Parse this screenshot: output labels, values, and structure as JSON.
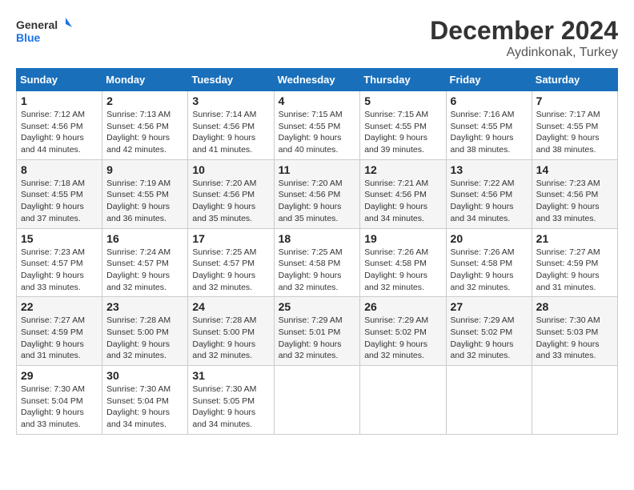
{
  "logo": {
    "line1": "General",
    "line2": "Blue"
  },
  "title": "December 2024",
  "location": "Aydinkonak, Turkey",
  "weekdays": [
    "Sunday",
    "Monday",
    "Tuesday",
    "Wednesday",
    "Thursday",
    "Friday",
    "Saturday"
  ],
  "weeks": [
    [
      {
        "day": "1",
        "sunrise": "7:12 AM",
        "sunset": "4:56 PM",
        "daylight": "9 hours and 44 minutes."
      },
      {
        "day": "2",
        "sunrise": "7:13 AM",
        "sunset": "4:56 PM",
        "daylight": "9 hours and 42 minutes."
      },
      {
        "day": "3",
        "sunrise": "7:14 AM",
        "sunset": "4:56 PM",
        "daylight": "9 hours and 41 minutes."
      },
      {
        "day": "4",
        "sunrise": "7:15 AM",
        "sunset": "4:55 PM",
        "daylight": "9 hours and 40 minutes."
      },
      {
        "day": "5",
        "sunrise": "7:15 AM",
        "sunset": "4:55 PM",
        "daylight": "9 hours and 39 minutes."
      },
      {
        "day": "6",
        "sunrise": "7:16 AM",
        "sunset": "4:55 PM",
        "daylight": "9 hours and 38 minutes."
      },
      {
        "day": "7",
        "sunrise": "7:17 AM",
        "sunset": "4:55 PM",
        "daylight": "9 hours and 38 minutes."
      }
    ],
    [
      {
        "day": "8",
        "sunrise": "7:18 AM",
        "sunset": "4:55 PM",
        "daylight": "9 hours and 37 minutes."
      },
      {
        "day": "9",
        "sunrise": "7:19 AM",
        "sunset": "4:55 PM",
        "daylight": "9 hours and 36 minutes."
      },
      {
        "day": "10",
        "sunrise": "7:20 AM",
        "sunset": "4:56 PM",
        "daylight": "9 hours and 35 minutes."
      },
      {
        "day": "11",
        "sunrise": "7:20 AM",
        "sunset": "4:56 PM",
        "daylight": "9 hours and 35 minutes."
      },
      {
        "day": "12",
        "sunrise": "7:21 AM",
        "sunset": "4:56 PM",
        "daylight": "9 hours and 34 minutes."
      },
      {
        "day": "13",
        "sunrise": "7:22 AM",
        "sunset": "4:56 PM",
        "daylight": "9 hours and 34 minutes."
      },
      {
        "day": "14",
        "sunrise": "7:23 AM",
        "sunset": "4:56 PM",
        "daylight": "9 hours and 33 minutes."
      }
    ],
    [
      {
        "day": "15",
        "sunrise": "7:23 AM",
        "sunset": "4:57 PM",
        "daylight": "9 hours and 33 minutes."
      },
      {
        "day": "16",
        "sunrise": "7:24 AM",
        "sunset": "4:57 PM",
        "daylight": "9 hours and 32 minutes."
      },
      {
        "day": "17",
        "sunrise": "7:25 AM",
        "sunset": "4:57 PM",
        "daylight": "9 hours and 32 minutes."
      },
      {
        "day": "18",
        "sunrise": "7:25 AM",
        "sunset": "4:58 PM",
        "daylight": "9 hours and 32 minutes."
      },
      {
        "day": "19",
        "sunrise": "7:26 AM",
        "sunset": "4:58 PM",
        "daylight": "9 hours and 32 minutes."
      },
      {
        "day": "20",
        "sunrise": "7:26 AM",
        "sunset": "4:58 PM",
        "daylight": "9 hours and 32 minutes."
      },
      {
        "day": "21",
        "sunrise": "7:27 AM",
        "sunset": "4:59 PM",
        "daylight": "9 hours and 31 minutes."
      }
    ],
    [
      {
        "day": "22",
        "sunrise": "7:27 AM",
        "sunset": "4:59 PM",
        "daylight": "9 hours and 31 minutes."
      },
      {
        "day": "23",
        "sunrise": "7:28 AM",
        "sunset": "5:00 PM",
        "daylight": "9 hours and 32 minutes."
      },
      {
        "day": "24",
        "sunrise": "7:28 AM",
        "sunset": "5:00 PM",
        "daylight": "9 hours and 32 minutes."
      },
      {
        "day": "25",
        "sunrise": "7:29 AM",
        "sunset": "5:01 PM",
        "daylight": "9 hours and 32 minutes."
      },
      {
        "day": "26",
        "sunrise": "7:29 AM",
        "sunset": "5:02 PM",
        "daylight": "9 hours and 32 minutes."
      },
      {
        "day": "27",
        "sunrise": "7:29 AM",
        "sunset": "5:02 PM",
        "daylight": "9 hours and 32 minutes."
      },
      {
        "day": "28",
        "sunrise": "7:30 AM",
        "sunset": "5:03 PM",
        "daylight": "9 hours and 33 minutes."
      }
    ],
    [
      {
        "day": "29",
        "sunrise": "7:30 AM",
        "sunset": "5:04 PM",
        "daylight": "9 hours and 33 minutes."
      },
      {
        "day": "30",
        "sunrise": "7:30 AM",
        "sunset": "5:04 PM",
        "daylight": "9 hours and 34 minutes."
      },
      {
        "day": "31",
        "sunrise": "7:30 AM",
        "sunset": "5:05 PM",
        "daylight": "9 hours and 34 minutes."
      },
      null,
      null,
      null,
      null
    ]
  ],
  "labels": {
    "sunrise": "Sunrise:",
    "sunset": "Sunset:",
    "daylight": "Daylight:"
  }
}
